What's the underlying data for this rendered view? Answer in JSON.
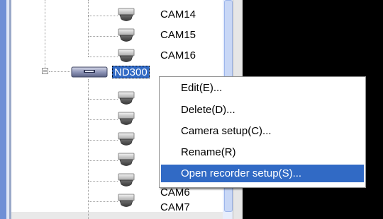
{
  "tree": {
    "cameras_top": [
      "CAM14",
      "CAM15",
      "CAM16"
    ],
    "recorder_label": "ND300",
    "cameras_bottom": [
      "CAM6",
      "CAM7"
    ],
    "expander_state": "expanded"
  },
  "context_menu": {
    "items": [
      "Edit(E)...",
      "Delete(D)...",
      "Camera setup(C)...",
      "Rename(R)",
      "Open recorder setup(S)..."
    ],
    "highlighted_index": 4
  },
  "colors": {
    "selection": "#316ac5",
    "scrollbar": "#c8d7f6",
    "background": "#000000"
  },
  "icons": {
    "camera": "dome-camera-icon",
    "recorder": "recorder-icon",
    "expander": "minus-icon"
  }
}
